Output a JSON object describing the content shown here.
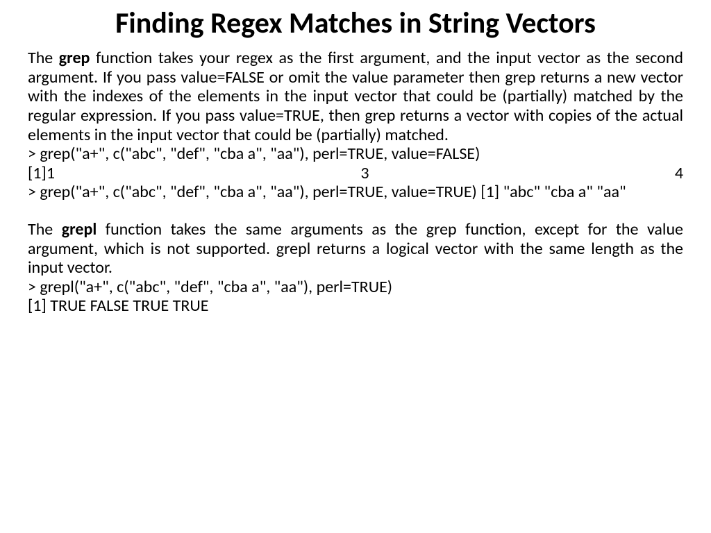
{
  "title": "Finding Regex Matches in String Vectors",
  "para1": {
    "pre": "The ",
    "bold": "grep",
    "post": " function takes your regex as the first argument, and the input vector as the second argument. If you pass value=FALSE or omit the value parameter then grep returns a new vector with the indexes of the elements in the input vector that could be (partially) matched by the regular expression. If you pass value=TRUE, then grep returns a vector with copies of the actual elements in the input vector that could be (partially) matched."
  },
  "code1": "> grep(\"a+\", c(\"abc\", \"def\", \"cba a\", \"aa\"), perl=TRUE, value=FALSE)",
  "output1": {
    "a": " [1]1",
    "b": "3",
    "c": "4"
  },
  "code2": "> grep(\"a+\", c(\"abc\", \"def\", \"cba a\", \"aa\"), perl=TRUE, value=TRUE) [1] \"abc\" \"cba a\" \"aa\"",
  "para2": {
    "pre": "The ",
    "bold": "grepl",
    "post": " function takes the same arguments as the grep function, except for the value argument, which is not supported. grepl returns a logical vector with the same length as the input vector."
  },
  "code3": "> grepl(\"a+\", c(\"abc\", \"def\", \"cba a\", \"aa\"), perl=TRUE)",
  "output3": "[1] TRUE FALSE TRUE TRUE"
}
